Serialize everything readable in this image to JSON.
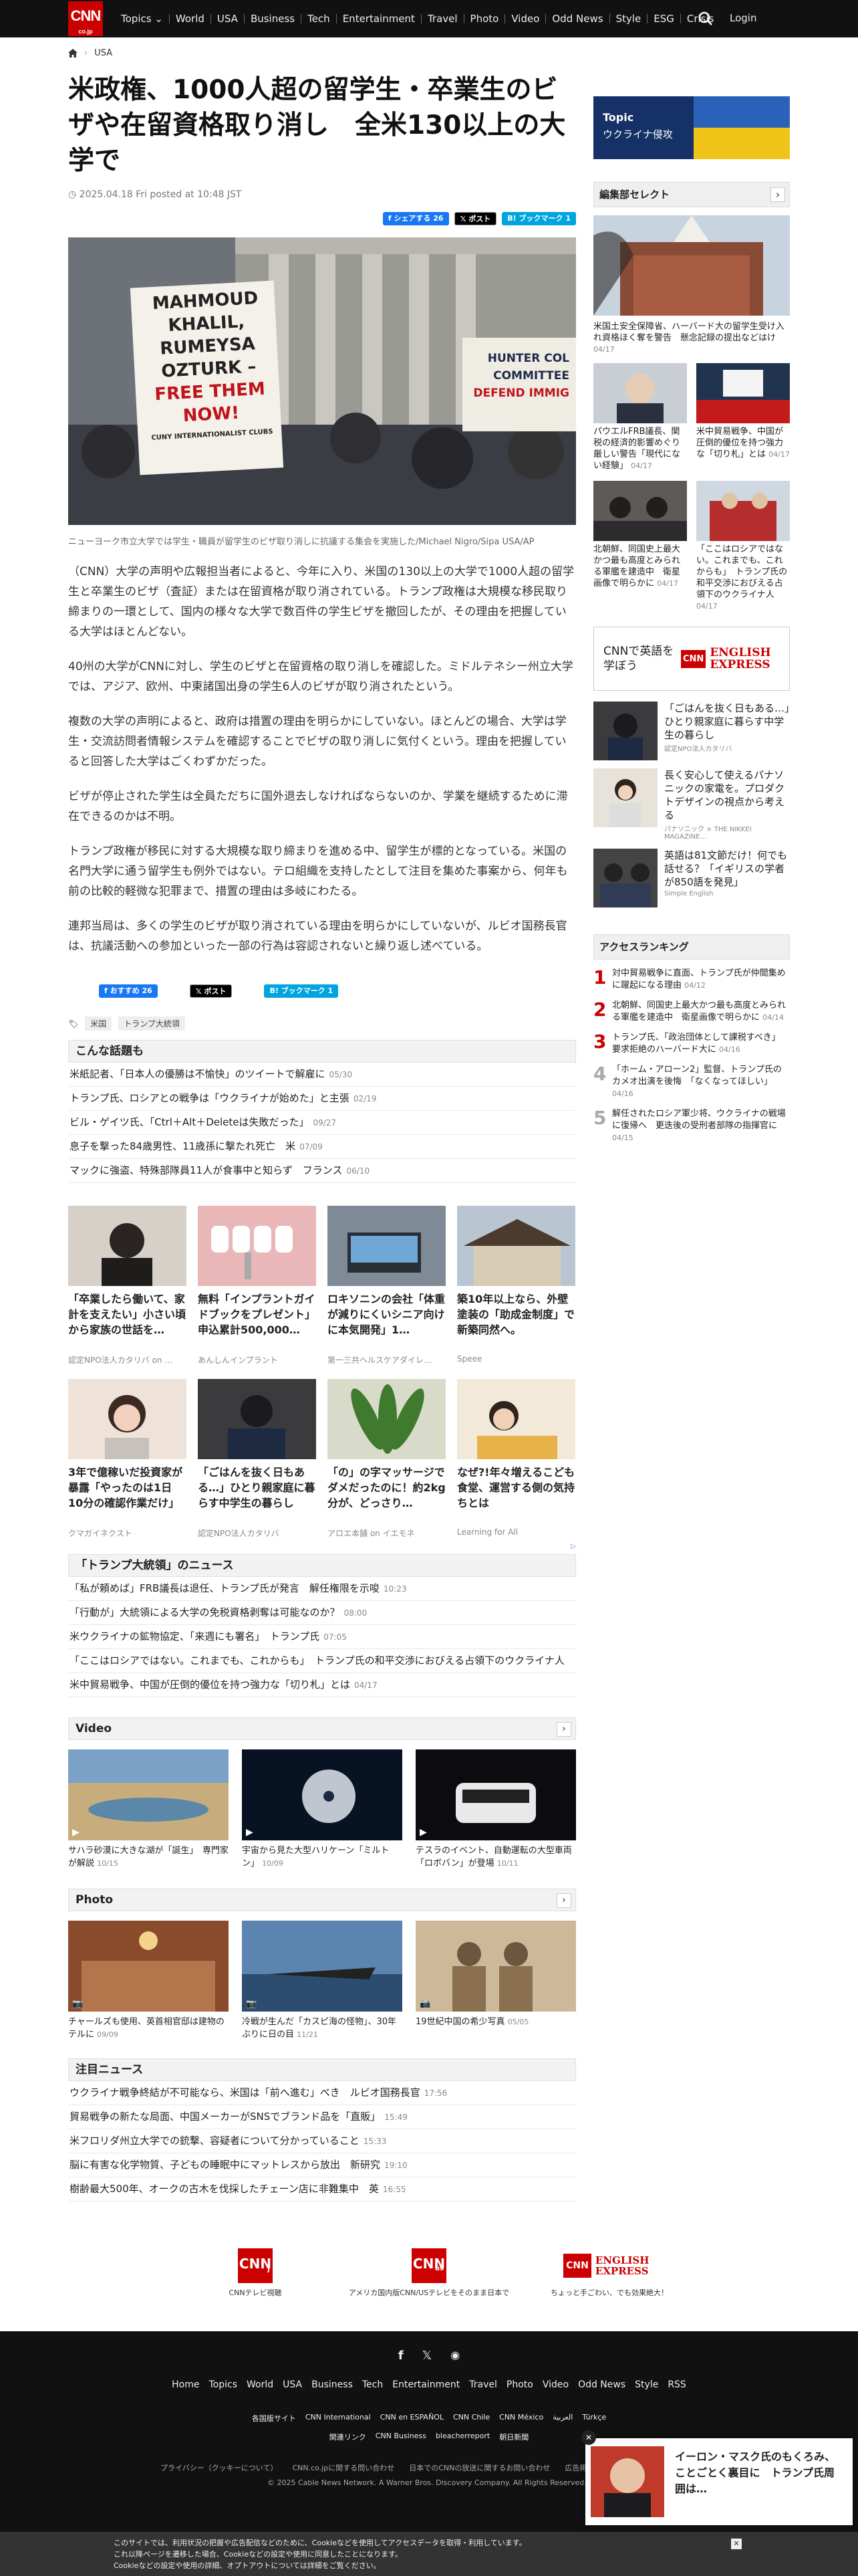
{
  "logo": {
    "main": "CNN",
    "sub": "co.jp"
  },
  "nav": [
    "Topics ⌄",
    "World",
    "USA",
    "Business",
    "Tech",
    "Entertainment",
    "Travel",
    "Photo",
    "Video",
    "Odd News",
    "Style",
    "ESG",
    "Crisis"
  ],
  "login": "Login",
  "breadcrumb": {
    "section": "USA"
  },
  "article": {
    "title": "米政権、1000人超の留学生・卒業生のビザや在留資格取り消し　全米130以上の大学で",
    "date": "2025.04.18 Fri posted at 10:48 JST",
    "share": {
      "facebook": "シェアする 26",
      "x": "ポスト",
      "hatena": "ブックマーク 1"
    },
    "hero_sign": [
      "MAHMOUD",
      "KHALIL,",
      "RUMEYSA",
      "OZTURK –",
      "FREE THEM",
      "NOW!"
    ],
    "hero_sign_footer": "CUNY INTERNATIONALIST CLUBS",
    "hero_sign_right": [
      "HUNTER COL",
      "COMMITTEE",
      "DEFEND IMMIG"
    ],
    "caption": "ニューヨーク市立大学では学生・職員が留学生のビザ取り消しに抗議する集会を実施した/Michael Nigro/Sipa USA/AP",
    "paragraphs": [
      "（CNN）大学の声明や広報担当者によると、今年に入り、米国の130以上の大学で1000人超の留学生と卒業生のビザ（査証）または在留資格が取り消されている。トランプ政権は大規模な移民取り締まりの一環として、国内の様々な大学で数百件の学生ビザを撤回したが、その理由を把握している大学はほとんどない。",
      "40州の大学がCNNに対し、学生のビザと在留資格の取り消しを確認した。ミドルテネシー州立大学では、アジア、欧州、中東諸国出身の学生6人のビザが取り消されたという。",
      "複数の大学の声明によると、政府は措置の理由を明らかにしていない。ほとんどの場合、大学は学生・交流訪問者情報システムを確認することでビザの取り消しに気付くという。理由を把握していると回答した大学はごくわずかだった。",
      "ビザが停止された学生は全員ただちに国外退去しなければならないのか、学業を継続するために滞在できるのかは不明。",
      "トランプ政権が移民に対する大規模な取り締まりを進める中、留学生が標的となっている。米国の名門大学に通う留学生も例外ではない。テロ組織を支持したとして注目を集めた事案から、何年も前の比較的軽微な犯罪まで、措置の理由は多岐にわたる。",
      "連邦当局は、多くの学生のビザが取り消されている理由を明らかにしていないが、ルビオ国務長官は、抗議活動への参加といった一部の行為は容認されないと繰り返し述べている。"
    ],
    "bottom_share": {
      "facebook": "おすすめ 26",
      "x": "ポスト",
      "hatena": "ブックマーク 1"
    },
    "tags": [
      "米国",
      "トランプ大統領"
    ]
  },
  "related": {
    "title": "こんな話題も",
    "items": [
      {
        "t": "米紙記者、「日本人の優勝は不愉快」のツイートで解雇に",
        "d": "05/30"
      },
      {
        "t": "トランプ氏、ロシアとの戦争は「ウクライナが始めた」と主張",
        "d": "02/19"
      },
      {
        "t": "ビル・ゲイツ氏、「Ctrl＋Alt＋Deleteは失敗だった」",
        "d": "09/27"
      },
      {
        "t": "息子を撃った84歳男性、11歳孫に撃たれ死亡　米",
        "d": "07/09"
      },
      {
        "t": "マックに強盗、特殊部隊員11人が食事中と知らず　フランス",
        "d": "06/10"
      }
    ]
  },
  "promo": [
    {
      "t": "「卒業したら働いて、家計を支えたい」小さい頃から家族の世話を…",
      "s": "認定NPO法人カタリバ on …"
    },
    {
      "t": "無料「インプラントガイドブックをプレゼント」申込累計500,000…",
      "s": "あんしんインプラント"
    },
    {
      "t": "ロキソニンの会社「体重が減りにくいシニア向けに本気開発」1…",
      "s": "第一三共ヘルスケアダイレ…"
    },
    {
      "t": "築10年以上なら、外壁塗装の「助成金制度」で新築同然へ。",
      "s": "Speee"
    },
    {
      "t": "3年で億稼いだ投資家が暴露「やったのは1日10分の確認作業だけ」",
      "s": "クマガイネクスト"
    },
    {
      "t": "「ごはんを抜く日もある…」ひとり親家庭に暮らす中学生の暮らし",
      "s": "認定NPO法人カタリバ"
    },
    {
      "t": "「の」の字マッサージでダメだったのに！約2kg分が、どっさり…",
      "s": "アロエ本舗 on イエモネ"
    },
    {
      "t": "なぜ?!年々増えるこども食堂、運営する側の気持ちとは",
      "s": "Learning for All"
    }
  ],
  "trump_news": {
    "title": "「トランプ大統領」のニュース",
    "items": [
      {
        "t": "「私が頼めば」FRB議長は退任、トランプ氏が発言　解任権限を示唆",
        "d": "10:23"
      },
      {
        "t": "「行動が」大統領による大学の免税資格剥奪は可能なのか？",
        "d": "08:00"
      },
      {
        "t": "米ウクライナの鉱物協定、「来週にも署名」　トランプ氏",
        "d": "07:05"
      },
      {
        "t": "「ここはロシアではない。これまでも、これからも」　トランプ氏の和平交渉におびえる占領下のウクライナ人",
        "d": ""
      },
      {
        "t": "米中貿易戦争、中国が圧倒的優位を持つ強力な「切り札」とは",
        "d": "04/17"
      }
    ]
  },
  "video": {
    "title": "Video",
    "items": [
      {
        "t": "サハラ砂漠に大きな湖が「誕生」　専門家が解説",
        "d": "10/15"
      },
      {
        "t": "宇宙から見た大型ハリケーン「ミルトン」",
        "d": "10/09"
      },
      {
        "t": "テスラのイベント、自動運転の大型車両「ロボバン」が登場",
        "d": "10/11"
      }
    ]
  },
  "photo": {
    "title": "Photo",
    "items": [
      {
        "t": "チャールズも使用、英首相官邸は建物のテルに",
        "d": "09/09"
      },
      {
        "t": "冷戦が生んだ「カスピ海の怪物」、30年ぶりに日の目",
        "d": "11/21"
      },
      {
        "t": "19世紀中国の希少写真",
        "d": "05/05"
      }
    ]
  },
  "featured": {
    "title": "注目ニュース",
    "items": [
      {
        "t": "ウクライナ戦争終結が不可能なら、米国は「前へ進む」べき　ルビオ国務長官",
        "d": "17:56"
      },
      {
        "t": "貿易戦争の新たな局面、中国メーカーがSNSでブランド品を「直販」",
        "d": "15:49"
      },
      {
        "t": "米フロリダ州立大学での銃撃、容疑者について分かっていること",
        "d": "15:33"
      },
      {
        "t": "脳に有害な化学物質、子どもの睡眠中にマットレスから放出　新研究",
        "d": "19:10"
      },
      {
        "t": "樹齢最大500年、オークの古木を伐採したチェーン店に非難集中　英",
        "d": "16:55"
      }
    ]
  },
  "bottom_banners": [
    {
      "logo": "CNN",
      "sub": "j",
      "label": "CNNテレビ視聴"
    },
    {
      "logo": "CNN",
      "sub": "us",
      "label": "アメリカ国内版CNN/USテレビをそのまま日本で"
    },
    {
      "logo": "ENGLISH EXPRESS",
      "sub": "CNN",
      "label": "ちょっと手ごわい、でも効果絶大！"
    }
  ],
  "sidebar": {
    "topic": {
      "label": "Topic",
      "title": "ウクライナ侵攻"
    },
    "editor_title": "編集部セレクト",
    "editor_lead": {
      "t": "米国土安全保障省、ハーバード大の留学生受け入れ資格ほく奪を警告　懸念記録の提出などはけ",
      "d": "04/17"
    },
    "editor_grid": [
      {
        "t": "パウエルFRB議長、関税の経済的影響めぐり厳しい警告「現代にない経験」",
        "d": "04/17"
      },
      {
        "t": "米中貿易戦争、中国が圧倒的優位を持つ強力な「切り札」とは",
        "d": "04/17"
      },
      {
        "t": "北朝鮮、同国史上最大かつ最も高度とみられる軍艦を建造中　衛星画像で明らかに",
        "d": "04/17"
      },
      {
        "t": "「ここはロシアではない。これまでも、これからも」　トランプ氏の和平交渉におびえる占領下のウクライナ人",
        "d": "04/17"
      }
    ],
    "english_banner": {
      "left": "CNNで英語を学ぼう",
      "logo": "CNN",
      "brand": "ENGLISH EXPRESS"
    },
    "promo": [
      {
        "t": "「ごはんを抜く日もある…」ひとり親家庭に暮らす中学生の暮らし",
        "s": "認定NPO法人カタリバ"
      },
      {
        "t": "長く安心して使えるパナソニックの家電を。プロダクトデザインの視点から考える",
        "s": "パナソニック × THE NIKKEI MAGAZINE…"
      },
      {
        "t": "英語は81文節だけ！何でも話せる？「イギリスの学者が850語を発見」",
        "s": "Simple English"
      }
    ],
    "ranking_title": "アクセスランキング",
    "ranking": [
      {
        "n": "1",
        "t": "対中貿易戦争に直面、トランプ氏が仲間集めに躍起になる理由",
        "d": "04/12"
      },
      {
        "n": "2",
        "t": "北朝鮮、同国史上最大かつ最も高度とみられる軍艦を建造中　衛星画像で明らかに",
        "d": "04/14"
      },
      {
        "n": "3",
        "t": "トランプ氏、「政治団体として課税すべき」　要求拒絶のハーバード大に",
        "d": "04/16"
      },
      {
        "n": "4",
        "t": "「ホーム・アローン2」監督、トランプ氏のカメオ出演を後悔　「なくなってほしい」",
        "d": "04/16"
      },
      {
        "n": "5",
        "t": "解任されたロシア軍少将、ウクライナの戦場に復帰へ　更迭後の受刑者部隊の指揮官に",
        "d": "04/15"
      }
    ]
  },
  "footer": {
    "nav": [
      "Home",
      "Topics",
      "World",
      "USA",
      "Business",
      "Tech",
      "Entertainment",
      "Travel",
      "Photo",
      "Video",
      "Odd News",
      "Style",
      "RSS"
    ],
    "editions": [
      "各国版サイト",
      "CNN International",
      "CNN en ESPAÑOL",
      "CNN Chile",
      "CNN México",
      "العربية",
      "Türkçe"
    ],
    "links": [
      "関連リンク",
      "CNN Business",
      "bleacherreport",
      "朝日新聞"
    ],
    "policy": [
      "プライバシー（クッキーについて）",
      "CNN.co.jpに関する問い合わせ",
      "日本でのCNNの放送に関するお問い合わせ",
      "広告掲載について"
    ],
    "copyright": "© 2025 Cable News Network. A Warner Bros. Discovery Company. All Rights Reserved."
  },
  "popup": {
    "t": "イーロン・マスク氏のもくろみ、ことごとく裏目に　トランプ氏周囲は…"
  },
  "cookie": {
    "lines": [
      "このサイトでは、利用状況の把握や広告配信などのために、Cookieなどを使用してアクセスデータを取得・利用しています。",
      "これ以降ページを遷移した場合、Cookieなどの設定や使用に同意したことになります。",
      "Cookieなどの設定や使用の詳細、オプトアウトについては詳細をご覧ください。"
    ]
  },
  "colors": {
    "brand": "#cc0000",
    "header": "#111111",
    "link": "#1877f2"
  }
}
